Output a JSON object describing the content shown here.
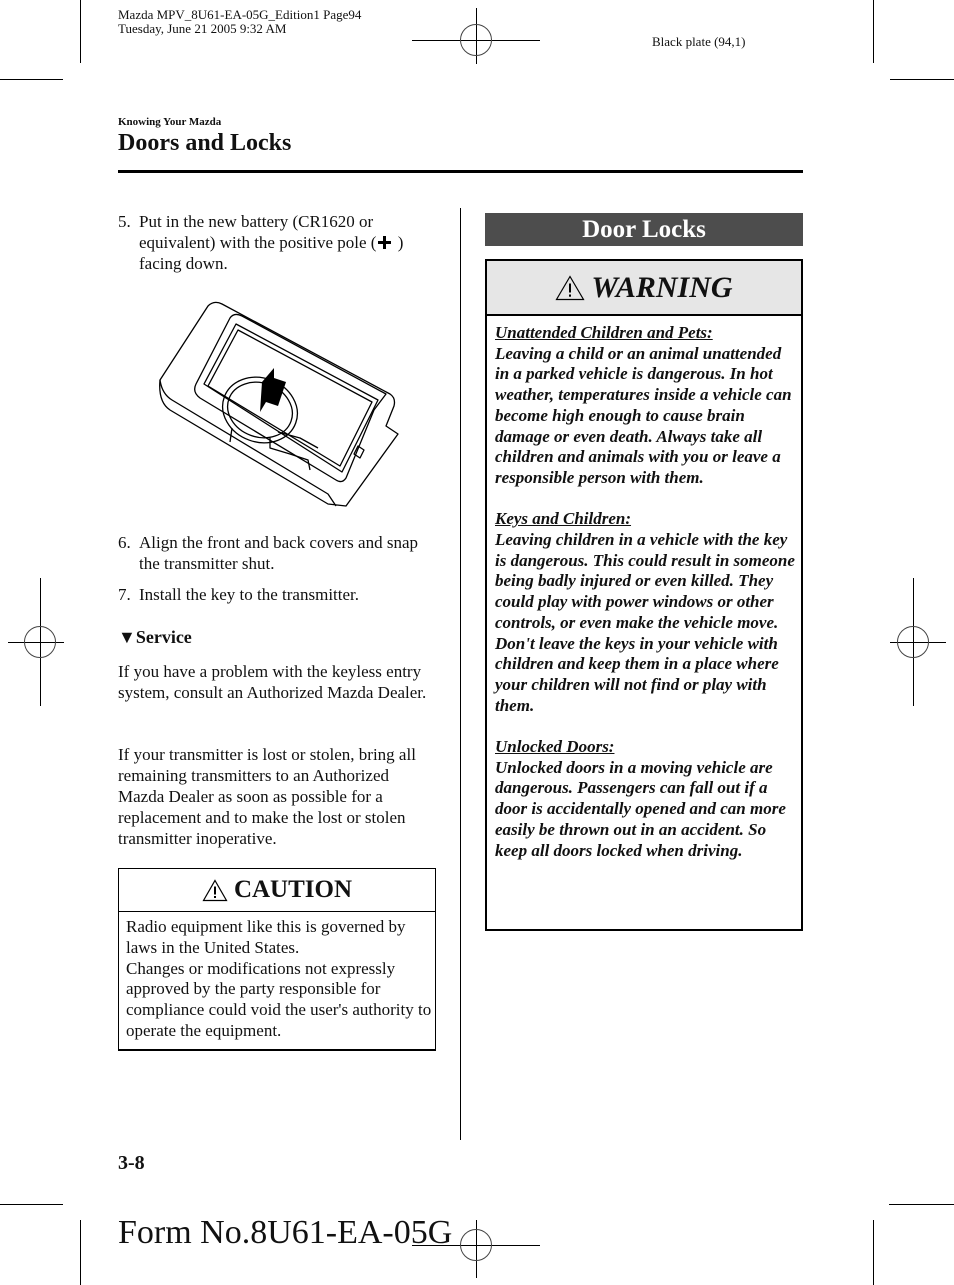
{
  "print_slug": {
    "line1": "Mazda MPV_8U61-EA-05G_Edition1 Page94",
    "line2": "Tuesday, June 21 2005 9:32 AM",
    "plate": "Black plate (94,1)"
  },
  "header": {
    "section_label": "Knowing Your Mazda",
    "page_title": "Doors and Locks"
  },
  "left_column": {
    "steps": [
      {
        "number": "5.",
        "text_before_icon": "Put in the new battery (CR1620 or equivalent) with the positive pole (",
        "icon": "plus-icon",
        "text_after_icon": " ) facing down."
      },
      {
        "number": "6.",
        "text": "Align the front and back covers and snap the transmitter shut."
      },
      {
        "number": "7.",
        "text": "Install the key to the transmitter."
      }
    ],
    "illustration": "battery-insertion-into-transmitter",
    "service": {
      "marker": "▼",
      "heading": "Service",
      "paragraphs": [
        "If you have a problem with the keyless entry system, consult an Authorized Mazda Dealer.",
        "If your transmitter is lost or stolen, bring all remaining transmitters to an Authorized Mazda Dealer as soon as possible for a replacement and to make the lost or stolen transmitter inoperative."
      ]
    },
    "caution": {
      "icon": "warning-triangle-icon",
      "title": "CAUTION",
      "lines": [
        "Radio equipment like this is governed by laws in the United States.",
        "Changes or modifications not expressly approved by the party responsible for compliance could void the user's authority to operate the equipment."
      ]
    }
  },
  "right_column": {
    "banner": "Door Locks",
    "warning": {
      "icon": "warning-triangle-icon",
      "title": "WARNING",
      "sections": [
        {
          "heading": "Unattended Children and Pets:",
          "text": "Leaving a child or an animal unattended in a parked vehicle is dangerous. In hot weather, temperatures inside a vehicle can become high enough to cause brain damage or even death. Always take all children and animals with you or leave a responsible person with them."
        },
        {
          "heading": "Keys and Children:",
          "text": "Leaving children in a vehicle with the key is dangerous. This could result in someone being badly injured or even killed. They could play with power windows or other controls, or even make the vehicle move. Don't leave the keys in your vehicle with children and keep them in a place where your children will not find or play with them."
        },
        {
          "heading": "Unlocked Doors:",
          "text": "Unlocked doors in a moving vehicle are dangerous. Passengers can fall out if a door is accidentally opened and can more easily be thrown out in an accident. So keep all doors locked when driving."
        }
      ]
    }
  },
  "footer": {
    "page_number": "3-8",
    "form_number": "Form No.8U61-EA-05G"
  }
}
